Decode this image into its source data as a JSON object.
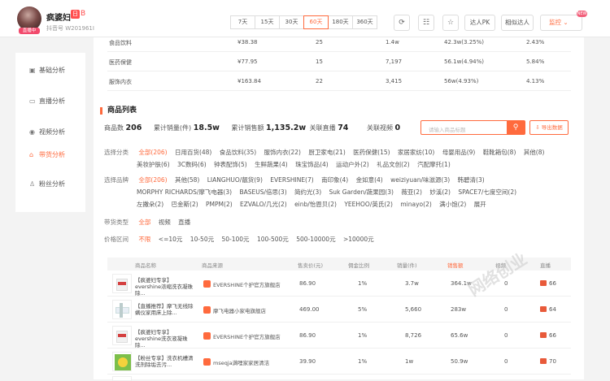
{
  "header": {
    "username": "疯婆妇",
    "tag": "日",
    "tag2": "B",
    "account_id": "抖音号 W201961I",
    "avatar_badge": "直播中",
    "day_ranges": [
      "7天",
      "15天",
      "30天",
      "60天",
      "180天",
      "360天"
    ],
    "active_range": "60天",
    "compare_label": "达人PK",
    "similar_label": "相似达人",
    "monitor_label": "监控",
    "new_badge": "NEW"
  },
  "sidebar": {
    "items": [
      {
        "label": "基础分析",
        "icon": "chart-icon"
      },
      {
        "label": "直播分析",
        "icon": "tv-icon"
      },
      {
        "label": "视频分析",
        "icon": "play-icon"
      },
      {
        "label": "带货分析",
        "icon": "cart-icon"
      },
      {
        "label": "粉丝分析",
        "icon": "user-icon"
      }
    ],
    "active_index": 3
  },
  "category_table": {
    "rows": [
      {
        "name": "食品饮料",
        "price": "¥38.38",
        "count": "25",
        "sales": "1.4w",
        "gmv": "42.3w(3.25%)",
        "share": "2.43%"
      },
      {
        "name": "医药保健",
        "price": "¥77.95",
        "count": "15",
        "sales": "7,197",
        "gmv": "56.1w(4.94%)",
        "share": "5.84%"
      },
      {
        "name": "服饰内衣",
        "price": "¥163.84",
        "count": "22",
        "sales": "3,415",
        "gmv": "56w(4.93%)",
        "share": "4.13%"
      }
    ]
  },
  "products": {
    "section_title": "商品列表",
    "stats": [
      {
        "label": "商品数",
        "value": "206"
      },
      {
        "label": "累计销量(件)",
        "value": "18.5w"
      },
      {
        "label": "累计销售额",
        "value": "1,135.2w"
      },
      {
        "label": "关联直播",
        "value": "74"
      },
      {
        "label": "关联视频",
        "value": "0"
      }
    ],
    "search_placeholder": "请输入商品标题",
    "export_label": "导出数据",
    "filters": {
      "category_label": "选择分类",
      "categories": [
        "全部(206)",
        "日用百货(48)",
        "食品饮料(35)",
        "服饰内衣(22)",
        "厨卫家电(21)",
        "医药保健(15)",
        "家居家纺(10)",
        "母婴用品(9)",
        "鞋靴箱包(8)",
        "其他(8)",
        "美妆护肤(6)",
        "3C数码(6)",
        "钟表配饰(5)",
        "生鲜蔬果(4)",
        "珠宝饰品(4)",
        "运动户外(2)",
        "礼品文创(2)",
        "汽配摩托(1)"
      ],
      "brand_label": "选择品牌",
      "brands": [
        "全部(206)",
        "其他(58)",
        "LIANGHUO/靓货(9)",
        "EVERSHINE(7)",
        "南印象(4)",
        "金如意(4)",
        "weiziyuan/味滋源(3)",
        "韩碧清(3)",
        "MORPHY RICHARDS/摩飞电器(3)",
        "BASEUS/倍思(3)",
        "简约光(3)",
        "Suk Garden/蔬果园(3)",
        "薇亚(2)",
        "妙溪(2)",
        "SPACE7/七度空间(2)",
        "左撇朵(2)",
        "巴金斯(2)",
        "PMPM(2)",
        "EZVALO/几光(2)",
        "einb/怡恩贝(2)",
        "YEEHOO/英氏(2)",
        "minayo(2)",
        "满小饱(2)",
        "展开"
      ],
      "type_label": "带货类型",
      "types": [
        "全部",
        "视频",
        "直播"
      ],
      "price_label": "价格区间",
      "prices": [
        "不限",
        "<=10元",
        "10-50元",
        "50-100元",
        "100-500元",
        "500-10000元",
        ">10000元"
      ]
    },
    "columns": [
      "商品名称",
      "商品来源",
      "售卖价(元)",
      "佣金比例",
      "销量(件)",
      "销售额",
      "视频",
      "直播"
    ],
    "rows": [
      {
        "name": "【疯婆妇专享】evershine浓缩洗衣凝珠除...",
        "source": "EVERSHINE个护官方旗舰店",
        "price": "86.90",
        "commission": "1%",
        "sales": "3.7w",
        "gmv": "364.1w",
        "video": "0",
        "live": "66"
      },
      {
        "name": "【直播推荐】摩飞无线除螨仪家用床上除...",
        "source": "摩飞电器小家电旗舰店",
        "price": "469.00",
        "commission": "5%",
        "sales": "5,660",
        "gmv": "283w",
        "video": "0",
        "live": "64"
      },
      {
        "name": "【疯婆妇专享】evershine洗衣液凝珠除...",
        "source": "EVERSHINE个护官方旗舰店",
        "price": "86.90",
        "commission": "1%",
        "sales": "8,726",
        "gmv": "65.6w",
        "video": "0",
        "live": "66"
      },
      {
        "name": "【粉丝专享】洗衣机槽清洗剂除垢去污...",
        "source": "mseqja满哩家家居清洁",
        "price": "39.90",
        "commission": "1%",
        "sales": "1w",
        "gmv": "50.9w",
        "video": "0",
        "live": "70"
      }
    ]
  },
  "watermark": "网络创业"
}
